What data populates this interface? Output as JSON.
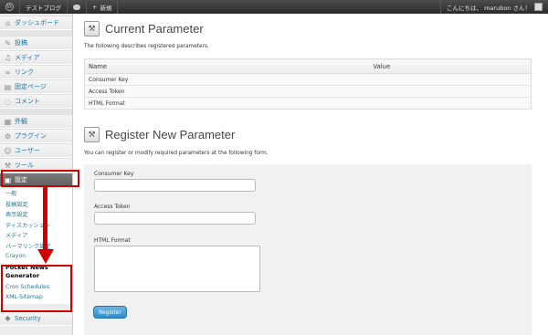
{
  "adminbar": {
    "site_name": "テストブログ",
    "new_label": "新規",
    "greeting": "こんにちは、 marubon さん！"
  },
  "sidebar": {
    "items": [
      {
        "label": "ダッシュボード",
        "icon": "dashboard-icon"
      },
      {
        "label": "投稿",
        "icon": "pin-icon"
      },
      {
        "label": "メディア",
        "icon": "media-icon"
      },
      {
        "label": "リンク",
        "icon": "link-icon"
      },
      {
        "label": "固定ページ",
        "icon": "page-icon"
      },
      {
        "label": "コメント",
        "icon": "comment-icon"
      },
      {
        "label": "外観",
        "icon": "appearance-icon"
      },
      {
        "label": "プラグイン",
        "icon": "plugin-icon"
      },
      {
        "label": "ユーザー",
        "icon": "users-icon"
      },
      {
        "label": "ツール",
        "icon": "tools-icon"
      },
      {
        "label": "設定",
        "icon": "settings-icon"
      }
    ],
    "submenu": [
      "一般",
      "投稿設定",
      "表示設定",
      "ディスカッション",
      "メディア",
      "パーマリンク設定",
      "Crayon",
      "Pocket News Generator",
      "Cron Schedules",
      "XML-Sitemap"
    ],
    "bottom": "Security"
  },
  "current": {
    "title": "Current Parameter",
    "desc": "The following describes registered parameters.",
    "col_name": "Name",
    "col_value": "Value",
    "rows": [
      "Consumer Key",
      "Access Token",
      "HTML Format"
    ]
  },
  "register": {
    "title": "Register New Parameter",
    "desc": "You can register or modify required parameters at the following form.",
    "ck_label": "Consumer Key",
    "at_label": "Access Token",
    "hf_label": "HTML Format",
    "button": "Register"
  },
  "colors": {
    "annotation": "#d00000",
    "link": "#21759b",
    "button": "#2e8dc8"
  }
}
